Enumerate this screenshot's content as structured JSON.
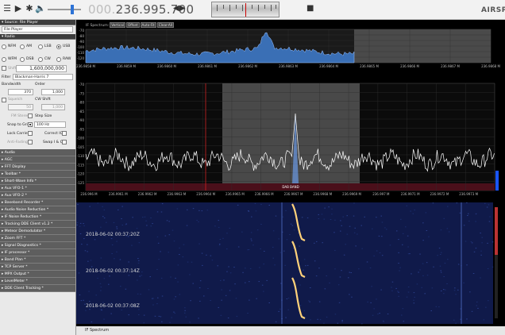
{
  "toolbar": {
    "frequency_lead": "000.",
    "frequency_main": "236.995.700",
    "freq_arrows": "◀▶",
    "brand": "AIRSPY",
    "icons": [
      "menu-icon",
      "play-icon",
      "gear-icon",
      "speaker-icon",
      "stop-icon"
    ]
  },
  "left": {
    "source": "Source: File Player",
    "source_select": "File Player",
    "radio_header": "Radio",
    "modes_row1": [
      "NFM",
      "AM",
      "LSB",
      "USB"
    ],
    "modes_row2": [
      "WFM",
      "DSB",
      "CW",
      "RAW"
    ],
    "selected_mode": "USB",
    "shift_label": "Shift",
    "center_freq": "1,600,000,000",
    "filter_label": "Filter",
    "filter_value": "Blackman-Harris 7",
    "bandwidth_label": "Bandwidth",
    "order_label": "Order",
    "bandwidth_value": "370",
    "order_value": "1,000",
    "squelch_label": "Squelch",
    "cw_shift_label": "CW Shift",
    "squelch_value": "50",
    "cw_shift_value": "1,000",
    "fm_stereo_label": "FM Stereo",
    "step_size_label": "Step Size",
    "snap_label": "Snap to Grid",
    "snap_value": "100 Hz",
    "lock_carrier_label": "Lock Carrier",
    "correct_iq_label": "Correct IQ",
    "anti_fading_label": "Anti-Fading",
    "swap_iq_label": "Swap I & Q",
    "plugins": [
      "Audio",
      "AGC",
      "FFT Display",
      "Toolbar *",
      "Short-Wave Info *",
      "Aux VFO-1 *",
      "Aux VFO-2 *",
      "Baseband Recorder *",
      "Audio Noise Reduction *",
      "IF Noise Reduction *",
      "Tracking DDE Client v1.2 *",
      "Meteor Demodulator *",
      "Zoom FFT *",
      "Signal Diagnostics *",
      "IF processor *",
      "Band Plan *",
      "TCP Server *",
      "MPX Output *",
      "LevelMeter *",
      "DDE Client Tracking *"
    ]
  },
  "if_spectrum": {
    "title": "IF Spectrum:",
    "chips": [
      "Vertical",
      "Offset",
      "Auto-Fit",
      "Clear-All"
    ],
    "y_ticks": [
      "-70",
      "-80",
      "-90",
      "-100",
      "-110",
      "-120"
    ],
    "x_ticks": [
      "236.9858 M",
      "236.9859 M",
      "236.9860 M",
      "236.9861 M",
      "236.9862 M",
      "236.9863 M",
      "236.9864 M",
      "236.9865 M",
      "236.9866 M",
      "236.9867 M",
      "236.9868 M"
    ]
  },
  "main_spectrum": {
    "y_ticks": [
      "-70",
      "-75",
      "-80",
      "-85",
      "-90",
      "-95",
      "-100",
      "-105",
      "-110",
      "-115",
      "-120",
      "-125"
    ],
    "x_ticks": [
      "236.996 M",
      "236.9961 M",
      "236.9962 M",
      "236.9963 M",
      "236.9964 M",
      "236.9965 M",
      "236.9966 M",
      "236.9967 M",
      "236.9968 M",
      "236.9969 M",
      "236.997 M",
      "236.9971 M",
      "236.9972 M",
      "236.9973 M"
    ],
    "band_label": "DAB BAND"
  },
  "waterfall": {
    "timestamps": [
      "2018-06-02 00:37:20Z",
      "2018-06-02 00:37:14Z",
      "2018-06-02 00:37:08Z"
    ]
  },
  "bottom": {
    "title": "IF Spectrum"
  },
  "colors": {
    "spectrum_fill": "#3a6fb5",
    "band_overlay": "#555555",
    "trace": "#ffffff",
    "dab_band": "#4a0f1a",
    "waterfall_bg": "#101a4a"
  }
}
